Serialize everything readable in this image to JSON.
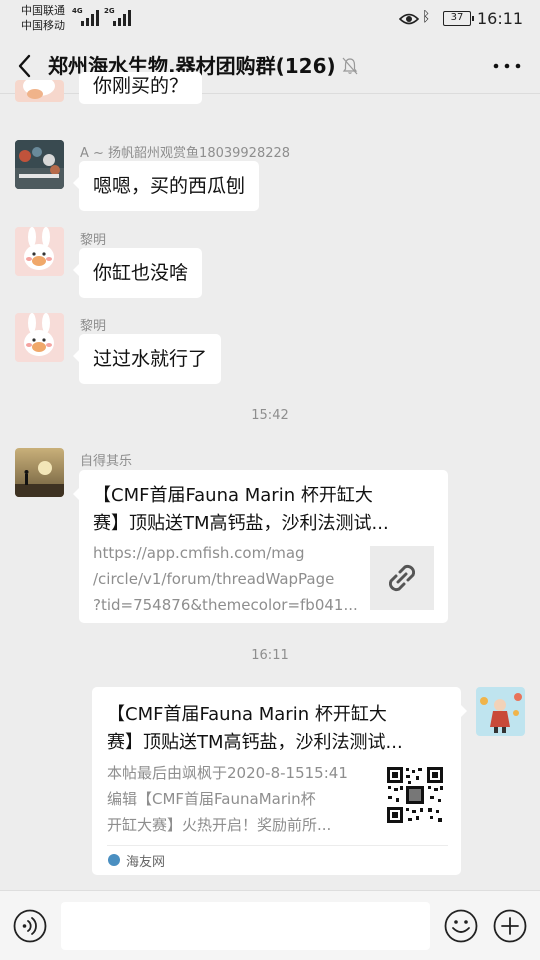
{
  "status_bar": {
    "carrier1": "中国联通",
    "carrier2": "中国移动",
    "net1": "4G",
    "net2": "2G",
    "battery": "37",
    "time": "16:11"
  },
  "header": {
    "title": "郑州海水生物,器材团购群(126)"
  },
  "messages": [
    {
      "text": "你刚买的？"
    },
    {
      "sender": "A ~ 扬帆韶州观赏鱼18039928228",
      "text": "嗯嗯，买的西瓜刨"
    },
    {
      "sender": "黎明",
      "text": "你缸也没啥"
    },
    {
      "sender": "黎明",
      "text": "过过水就行了"
    }
  ],
  "timestamps": [
    "15:42",
    "16:11"
  ],
  "link_card_1": {
    "sender": "自得其乐",
    "title_line1": "【CMF首届Fauna Marin 杯开缸大",
    "title_line2": "赛】顶贴送TM高钙盐，沙利法测试...",
    "url_line1": "https://app.cmfish.com/mag",
    "url_line2": "/circle/v1/forum/threadWapPage",
    "url_line3": "?tid=754876&themecolor=fb041..."
  },
  "link_card_2": {
    "title_line1": "【CMF首届Fauna Marin 杯开缸大",
    "title_line2": "赛】顶贴送TM高钙盐，沙利法测试...",
    "desc_line1": "本帖最后由飒枫于2020-8-1515:41",
    "desc_line2": "编辑【CMF首届FaunaMarin杯",
    "desc_line3": "开缸大赛】火热开启！奖励前所...",
    "source": "海友网"
  },
  "colors": {
    "background": "#ededed",
    "bubble": "#ffffff",
    "meta_text": "#8e8e8e"
  }
}
